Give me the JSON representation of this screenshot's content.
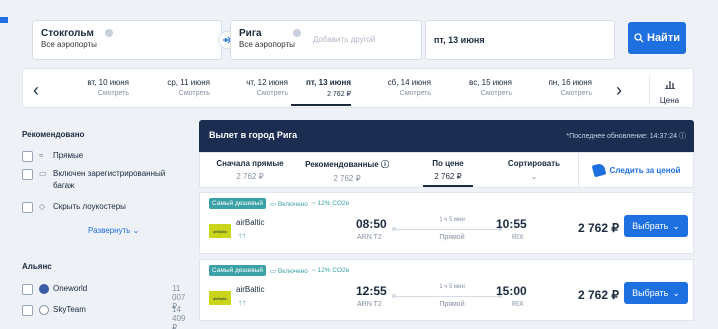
{
  "search": {
    "from_city": "Стокгольм",
    "from_sub": "Все аэропорты",
    "to_city": "Рига",
    "to_sub": "Все аэропорты",
    "add_another": "Добавить другой",
    "date": "пт, 13 июня",
    "find_label": "Найти"
  },
  "dates": {
    "items": [
      {
        "day": "вт, 10 июня",
        "sub": "Смотреть"
      },
      {
        "day": "ср, 11 июня",
        "sub": "Смотреть"
      },
      {
        "day": "чт, 12 июня",
        "sub": "Смотреть"
      },
      {
        "day": "пт, 13 июня",
        "sub": "2 762 ₽"
      },
      {
        "day": "сб, 14 июня",
        "sub": "Смотреть"
      },
      {
        "day": "вс, 15 июня",
        "sub": "Смотреть"
      },
      {
        "day": "пн, 16 июня",
        "sub": "Смотреть"
      }
    ],
    "price_label": "Цена"
  },
  "sidebar": {
    "recommended_title": "Рекомендовано",
    "filters": [
      {
        "label": "Прямые"
      },
      {
        "label": "Включен зарегистрированный багаж"
      },
      {
        "label": "Скрыть лоукостеры"
      }
    ],
    "expand_label": "Развернуть",
    "alliance_title": "Альянс",
    "alliances": [
      {
        "name": "Oneworld",
        "price": "11 007 ₽"
      },
      {
        "name": "SkyTeam",
        "price": "14 409 ₽"
      }
    ]
  },
  "results": {
    "title": "Вылет в город Рига",
    "updated": "*Последнее обновление: 14:37:24",
    "sort": [
      {
        "title": "Сначала прямые",
        "price": "2 762 ₽"
      },
      {
        "title": "Рекомендованные",
        "price": "2 762 ₽"
      },
      {
        "title": "По цене",
        "price": "2 762 ₽"
      },
      {
        "title": "Сортировать",
        "price": ""
      }
    ],
    "follow_label": "Следить за ценой",
    "flights": [
      {
        "tag_cheapest": "Самый дешевый",
        "tag_luggage": "Включено",
        "tag_co2": "~ 12% CO2e",
        "airline": "airBaltic",
        "logo_text": "airBaltic",
        "dep_time": "08:50",
        "dep_airport": "ARN T2",
        "duration": "1 ч 5 мин",
        "kind": "Прямой",
        "arr_time": "10:55",
        "arr_airport": "RIX",
        "price": "2 762 ₽",
        "choose": "Выбрать"
      },
      {
        "tag_cheapest": "Самый дешевый",
        "tag_luggage": "Включено",
        "tag_co2": "~ 12% CO2e",
        "airline": "airBaltic",
        "logo_text": "airBaltic",
        "dep_time": "12:55",
        "dep_airport": "ARN T2",
        "duration": "1 ч 5 мин",
        "kind": "Прямой",
        "arr_time": "15:00",
        "arr_airport": "RIX",
        "price": "2 762 ₽",
        "choose": "Выбрать"
      }
    ]
  },
  "colors": {
    "accent": "#1e6fe0",
    "header_dark": "#1c2d52",
    "teal": "#3aa1a6"
  }
}
